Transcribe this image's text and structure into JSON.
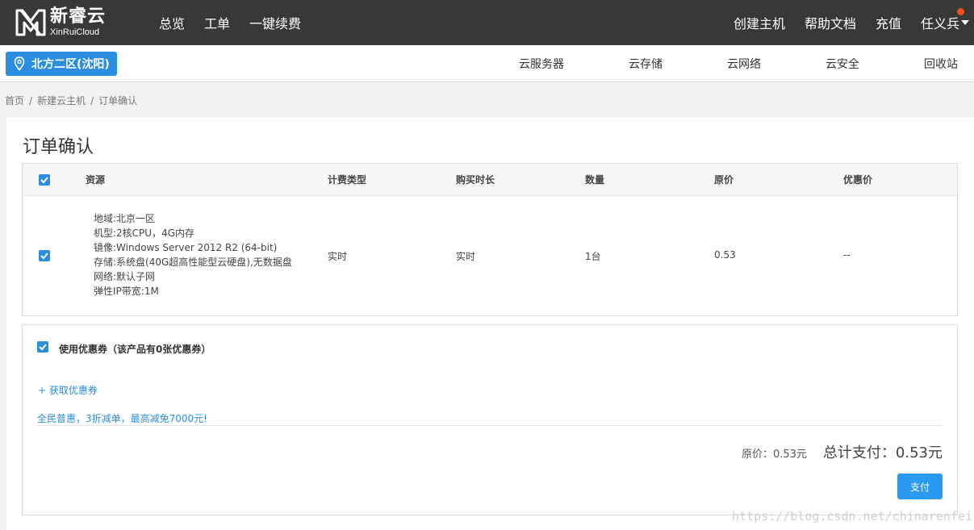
{
  "header": {
    "logo_cn": "新睿云",
    "logo_en": "XinRuiCloud",
    "nav_left": [
      "总览",
      "工单",
      "一键续费"
    ],
    "nav_right": [
      "创建主机",
      "帮助文档",
      "充值"
    ],
    "user_name": "任义兵"
  },
  "subbar": {
    "region": "北方二区(沈阳)",
    "nav": [
      "云服务器",
      "云存储",
      "云网络",
      "云安全",
      "回收站"
    ]
  },
  "breadcrumb": [
    "首页",
    "新建云主机",
    "订单确认"
  ],
  "page_title": "订单确认",
  "table": {
    "headers": [
      "资源",
      "计费类型",
      "购买时长",
      "数量",
      "原价",
      "优惠价"
    ],
    "row": {
      "resource_lines": [
        "地域:北京一区",
        "机型:2核CPU，4G内存",
        "镜像:Windows Server 2012 R2 (64-bit)",
        "存储:系统盘(40G超高性能型云硬盘),无数据盘",
        "网络:默认子网",
        "弹性IP带宽:1M"
      ],
      "billing": "实时",
      "duration": "实时",
      "quantity": "1台",
      "price": "0.53",
      "discount": "--"
    }
  },
  "coupon": {
    "label": "使用优惠券（该产品有0张优惠券）",
    "get_link": "+ 获取优惠券",
    "promo": "全民普惠，3折减单，最高减免7000元!"
  },
  "summary": {
    "original": "原价：0.53元",
    "total": "总计支付：0.53元",
    "pay_button": "支付"
  },
  "watermark": "https://blog.csdn.net/chinarenfei",
  "colors": {
    "header_bg": "#383838",
    "accent": "#2a8de0",
    "notify_dot": "#e8501f"
  }
}
